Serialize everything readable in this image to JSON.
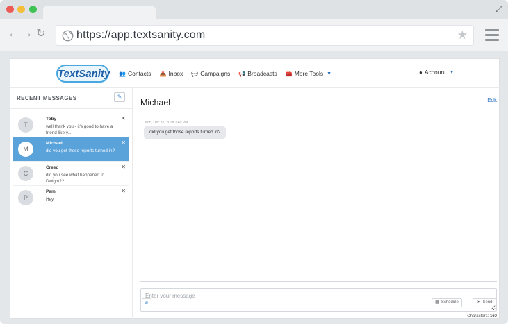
{
  "browser": {
    "url": "https://app.textsanity.com"
  },
  "app": {
    "logo": "TextSanity",
    "nav": [
      {
        "label": "Contacts",
        "icon": "users-icon"
      },
      {
        "label": "Inbox",
        "icon": "inbox-icon"
      },
      {
        "label": "Campaigns",
        "icon": "chat-icon"
      },
      {
        "label": "Broadcasts",
        "icon": "megaphone-icon"
      },
      {
        "label": "More Tools",
        "icon": "toolbox-icon"
      }
    ],
    "account": "Account"
  },
  "sidebar": {
    "title": "RECENT MESSAGES",
    "messages": [
      {
        "initial": "T",
        "name": "Toby",
        "preview": "well thank you - it's good to have a friend like y..."
      },
      {
        "initial": "M",
        "name": "Michael",
        "preview": "did you get those reports turned in?"
      },
      {
        "initial": "C",
        "name": "Creed",
        "preview": "did you see what happened to Dwight??"
      },
      {
        "initial": "P",
        "name": "Pam",
        "preview": "Hey"
      }
    ]
  },
  "chat": {
    "contact": "Michael",
    "edit": "Edit",
    "timestamp": "Mon, Dec 31, 2018 1:40 PM",
    "message": "did you get those reports turned in?",
    "placeholder": "Enter your message",
    "characters_label": "Characters:",
    "characters_count": "160",
    "schedule": "Schedule",
    "send": "Send"
  },
  "colors": {
    "accent": "#5aa2da",
    "link": "#3a7fc6"
  }
}
